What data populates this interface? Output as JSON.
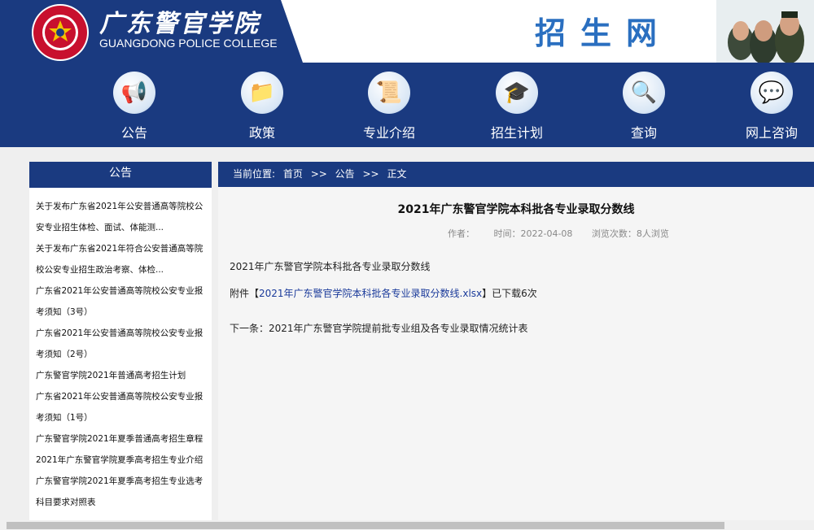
{
  "header": {
    "cn_title": "广东警官学院",
    "en_title": "GUANGDONG POLICE COLLEGE",
    "logo_ring_text": "广东警官学院 GUANGDONG POLICE COLLEGE",
    "site_name": "招生网"
  },
  "nav": [
    {
      "label": "公告",
      "icon": "megaphone-icon"
    },
    {
      "label": "政策",
      "icon": "folder-icon"
    },
    {
      "label": "专业介绍",
      "icon": "diploma-icon"
    },
    {
      "label": "招生计划",
      "icon": "graduation-cap-icon"
    },
    {
      "label": "查询",
      "icon": "magnifier-icon"
    },
    {
      "label": "网上咨询",
      "icon": "chat-bubble-icon"
    }
  ],
  "sidebar": {
    "title": "公告",
    "items": [
      "关于发布广东省2021年公安普通高等院校公安专业招生体检、面试、体能测...",
      "关于发布广东省2021年符合公安普通高等院校公安专业招生政治考察、体检...",
      "广东省2021年公安普通高等院校公安专业报考须知（3号）",
      "广东省2021年公安普通高等院校公安专业报考须知（2号）",
      "广东警官学院2021年普通高考招生计划",
      "广东省2021年公安普通高等院校公安专业报考须知（1号）",
      "广东警官学院2021年夏季普通高考招生章程",
      "2021年广东警官学院夏季高考招生专业介绍",
      "广东警官学院2021年夏季高考招生专业选考科目要求对照表"
    ]
  },
  "breadcrumb": {
    "prefix": "当前位置:",
    "home": "首页",
    "sep1": ">>",
    "section": "公告",
    "sep2": ">>",
    "current": "正文"
  },
  "article": {
    "title": "2021年广东警官学院本科批各专业录取分数线",
    "author_label": "作者：",
    "time_label": "时间：2022-04-08",
    "views_label": "浏览次数：8人浏览",
    "body_text": "2021年广东警官学院本科批各专业录取分数线",
    "attachment_prefix": "附件【",
    "attachment_link": "2021年广东警官学院本科批各专业录取分数线.xlsx",
    "attachment_suffix": "】已下载6次",
    "next_label": "下一条：2021年广东警官学院提前批专业组及各专业录取情况统计表"
  },
  "colors": {
    "nav_blue": "#1a3a80",
    "site_name_blue": "#2a6fc0",
    "link_blue": "#1a3a9a"
  }
}
